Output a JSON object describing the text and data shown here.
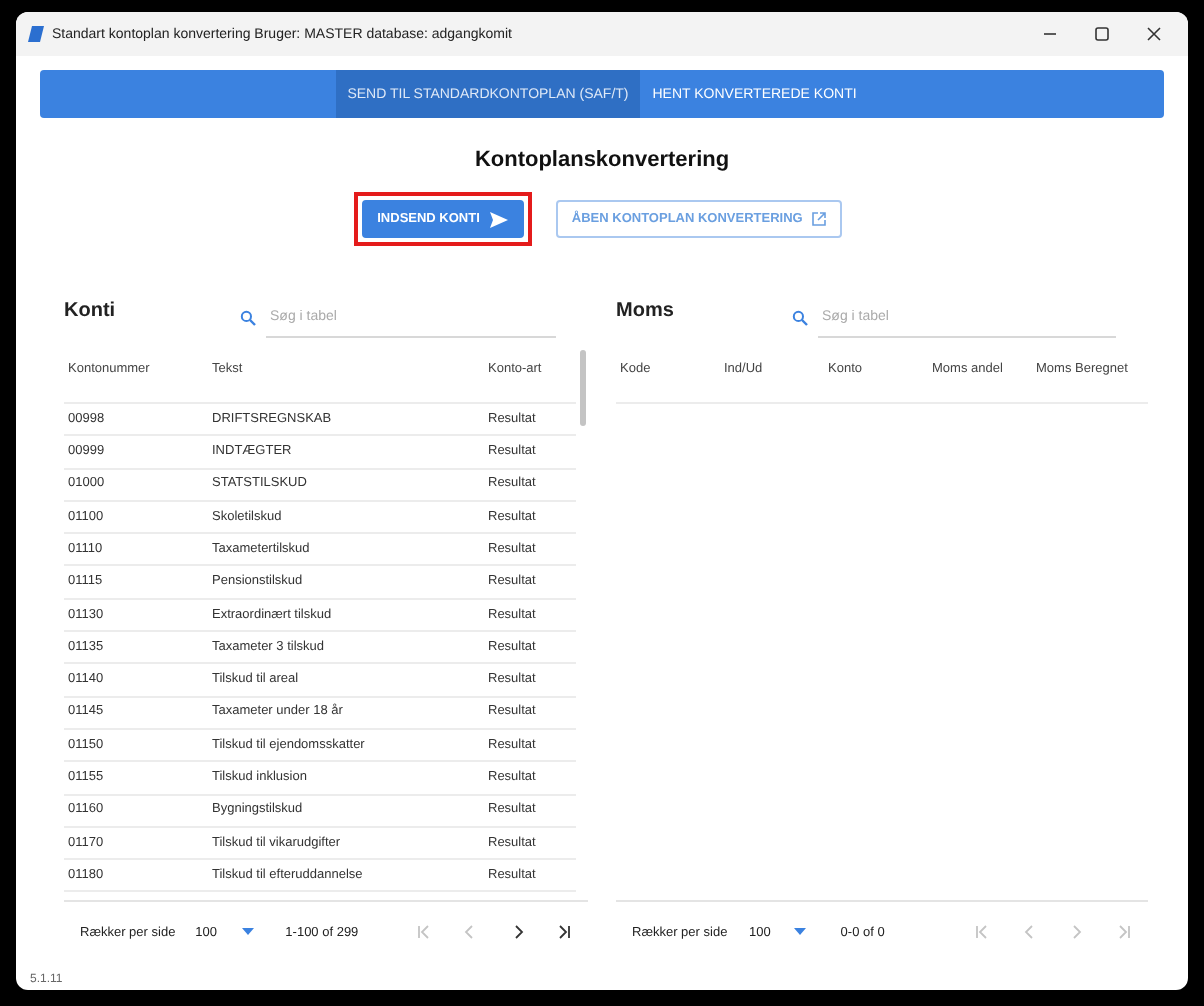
{
  "window": {
    "title": "Standart kontoplan konvertering Bruger: MASTER database: adgangkomit"
  },
  "tabs": [
    {
      "label": "SEND TIL STANDARDKONTOPLAN (SAF/T)",
      "selected": true
    },
    {
      "label": "HENT KONVERTEREDE KONTI",
      "selected": false
    }
  ],
  "heading": "Kontoplanskonvertering",
  "actions": [
    {
      "label": "INDSEND KONTI",
      "kind": "primary",
      "highlighted": true
    },
    {
      "label": "ÅBEN KONTOPLAN KONVERTERING",
      "kind": "outline",
      "highlighted": false
    }
  ],
  "panels": [
    {
      "title": "Konti",
      "search": {
        "placeholder": "Søg i tabel"
      },
      "columns": [
        "Kontonummer",
        "Tekst",
        "Konto-art"
      ],
      "rows": [
        [
          "00998",
          "DRIFTSREGNSKAB",
          "Resultat"
        ],
        [
          "00999",
          "INDTÆGTER",
          "Resultat"
        ],
        [
          "01000",
          "STATSTILSKUD",
          "Resultat"
        ],
        [
          "01100",
          "Skoletilskud",
          "Resultat"
        ],
        [
          "01110",
          "Taxametertilskud",
          "Resultat"
        ],
        [
          "01115",
          "Pensionstilskud",
          "Resultat"
        ],
        [
          "01130",
          "Extraordinært tilskud",
          "Resultat"
        ],
        [
          "01135",
          "Taxameter 3 tilskud",
          "Resultat"
        ],
        [
          "01140",
          "Tilskud til areal",
          "Resultat"
        ],
        [
          "01145",
          "Taxameter under 18 år",
          "Resultat"
        ],
        [
          "01150",
          "Tilskud til ejendomsskatter",
          "Resultat"
        ],
        [
          "01155",
          "Tilskud inklusion",
          "Resultat"
        ],
        [
          "01160",
          "Bygningstilskud",
          "Resultat"
        ],
        [
          "01170",
          "Tilskud til vikarudgifter",
          "Resultat"
        ],
        [
          "01180",
          "Tilskud til efteruddannelse",
          "Resultat"
        ]
      ],
      "pagination": {
        "label": "Rækker per side",
        "per_page": "100",
        "range": "1-100 of 299",
        "first_disabled": true,
        "prev_disabled": true,
        "next_disabled": false,
        "last_disabled": false
      }
    },
    {
      "title": "Moms",
      "search": {
        "placeholder": "Søg i tabel"
      },
      "columns": [
        "Kode",
        "Ind/Ud",
        "Konto",
        "Moms andel",
        "Moms Beregnet"
      ],
      "pagination": {
        "label": "Rækker per side",
        "per_page": "100",
        "range": "0-0 of 0",
        "first_disabled": true,
        "prev_disabled": true,
        "next_disabled": true,
        "last_disabled": true
      }
    }
  ],
  "version": "5.1.11"
}
